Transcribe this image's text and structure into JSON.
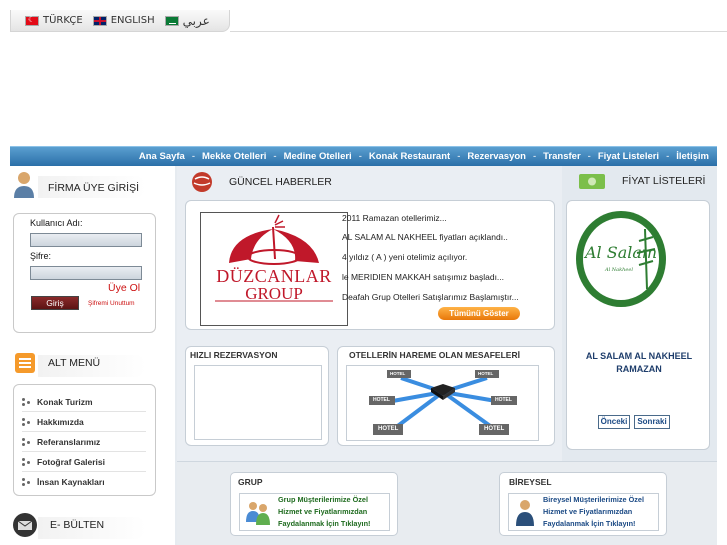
{
  "languages": [
    {
      "label": "TÜRKÇE",
      "flag": "flag-tr-icon"
    },
    {
      "label": "ENGLISH",
      "flag": "flag-uk-icon"
    },
    {
      "label": "عربي",
      "flag": "flag-sa-icon"
    }
  ],
  "nav": [
    "Ana Sayfa",
    "Mekke Otelleri",
    "Medine Otelleri",
    "Konak Restaurant",
    "Rezervasyon",
    "Transfer",
    "Fiyat Listeleri",
    "İletişim"
  ],
  "nav_separator": "-",
  "login": {
    "title": "FİRMA ÜYE GİRİŞİ",
    "username_label": "Kullanıcı Adı:",
    "password_label": "Şifre:",
    "register_link": "Üye Ol",
    "login_button": "Giriş",
    "forgot_link": "Şifremi Unuttum"
  },
  "alt_menu": {
    "title": "ALT MENÜ",
    "items": [
      "Konak Turizm",
      "Hakkımızda",
      "Referanslarımız",
      "Fotoğraf Galerisi",
      "İnsan Kaynakları"
    ]
  },
  "bulletin": {
    "title": "E- BÜLTEN"
  },
  "news": {
    "title": "GÜNCEL HABERLER",
    "logo_line1": "DÜZCANLAR",
    "logo_line2": "GROUP",
    "items": [
      "2011 Ramazan otellerimiz...",
      "AL SALAM AL NAKHEEL fiyatları açıklandı..",
      "4 yıldız ( A ) yeni otelimiz açılıyor.",
      "le MERIDIEN MAKKAH satışımız başladı...",
      "Deafah Grup Otelleri Satışlarımız Başlamıştır..."
    ],
    "show_all": "Tümünü Göster"
  },
  "quick_reservation": {
    "title": "HIZLI REZERVASYON"
  },
  "distances": {
    "title": "OTELLERİN HAREME OLAN MESAFELERİ",
    "hotel_label": "HOTEL"
  },
  "price_lists": {
    "title": "FİYAT LİSTELERİ",
    "logo_text": "Al Salam",
    "logo_sub": "Al Nakheel",
    "hotel_name_line1": "AL SALAM AL NAKHEEL",
    "hotel_name_line2": "RAMAZAN",
    "prev": "Önceki",
    "next": "Sonraki"
  },
  "group": {
    "title": "GRUP",
    "text": [
      "Grup Müşterilerimize Özel",
      "Hizmet ve Fiyatlarımızdan",
      "Faydalanmak İçin Tıklayın!"
    ]
  },
  "individual": {
    "title": "BİREYSEL",
    "text": [
      "Bireysel Müşterilerimize Özel",
      "Hizmet ve Fiyatlarımızdan",
      "Faydalanmak İçin Tıklayın!"
    ]
  },
  "colors": {
    "nav_bg": "#3a82bd",
    "brand_red": "#c0182a",
    "link_red": "#cc1111",
    "promo_green": "#1f6b1f",
    "button_orange": "#f08a1c"
  }
}
